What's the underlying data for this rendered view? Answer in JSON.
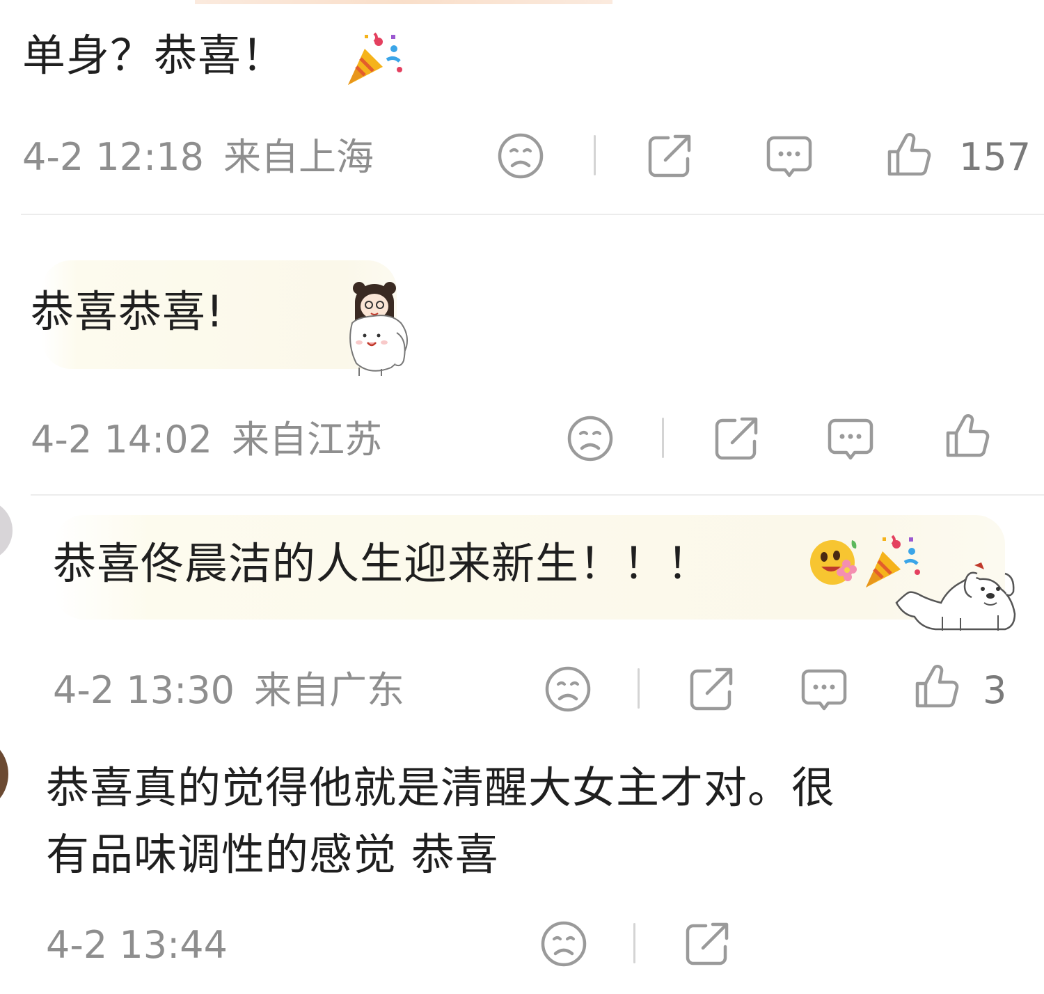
{
  "comments": [
    {
      "text": "单身？恭喜！",
      "time": "4-2 12:18",
      "location": "来自上海",
      "likes": "157",
      "emojis": [
        "party-popper"
      ]
    },
    {
      "text": "恭喜恭喜!",
      "time": "4-2 14:02",
      "location": "来自江苏",
      "likes": "",
      "stickers": [
        "girl-with-white-dog-sticker"
      ]
    },
    {
      "text": "恭喜佟晨洁的人生迎来新生！！！",
      "time": "4-2 13:30",
      "location": "来自广东",
      "likes": "3",
      "emojis": [
        "happy-flower-face",
        "party-popper"
      ],
      "stickers": [
        "lounging-dog-sticker"
      ]
    },
    {
      "text_line1": "恭喜真的觉得他就是清醒大女主才对。很",
      "text_line2": "有品味调性的感觉 恭喜",
      "time": "4-2 13:44"
    }
  ],
  "actions": {
    "dislike_icon": "sad-face-icon",
    "share_icon": "share-icon",
    "reply_icon": "comment-bubble-icon",
    "like_icon": "thumbs-up-icon"
  },
  "colors": {
    "text": "#1f1f1f",
    "meta": "#8e8e8e",
    "icon": "#9a9a9a",
    "bubble": "#fbf8ea"
  }
}
